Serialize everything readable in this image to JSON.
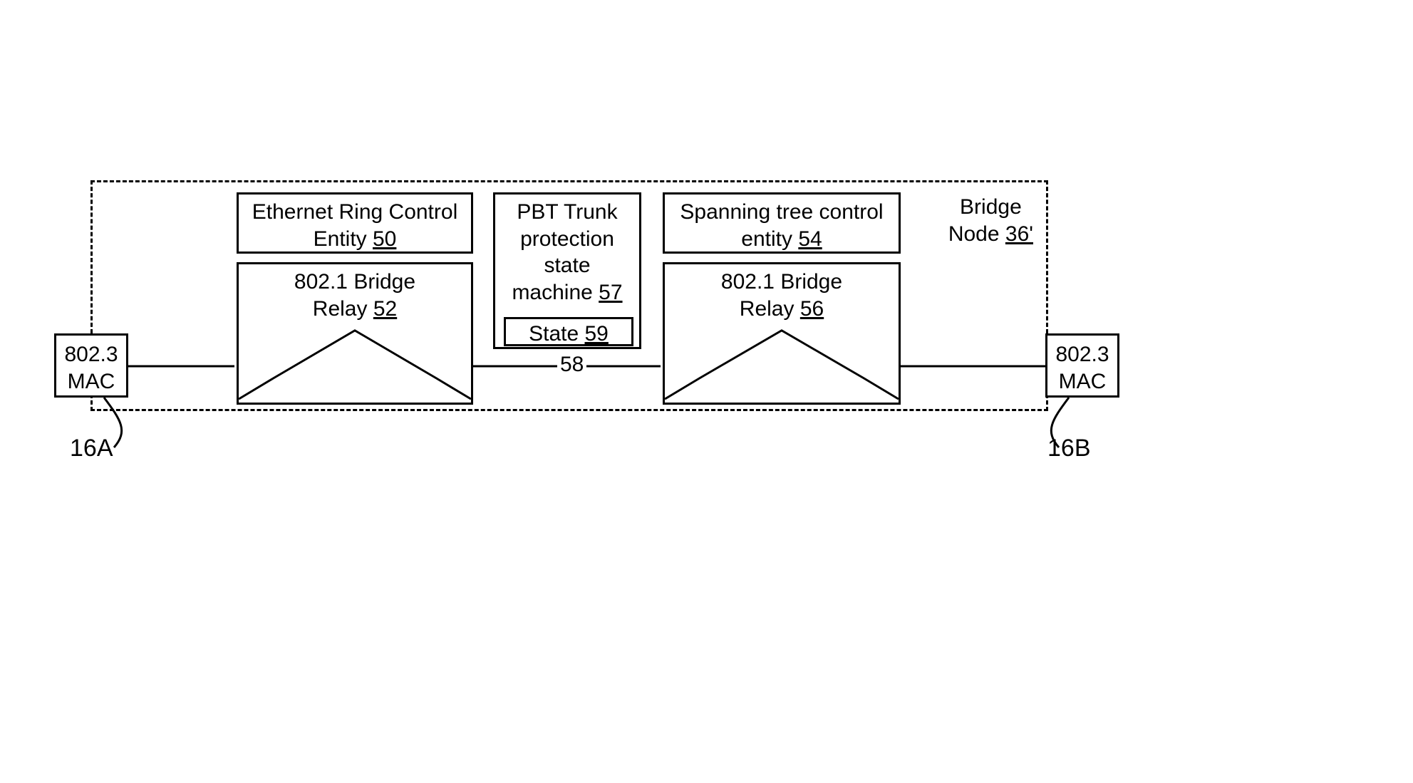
{
  "bridge": {
    "label_line1": "Bridge",
    "label_line2_prefix": "Node ",
    "label_num": "36'"
  },
  "ethernet_ring": {
    "line1": "Ethernet Ring Control",
    "line2_prefix": "Entity ",
    "num": "50"
  },
  "relay_left": {
    "line1": "802.1 Bridge",
    "line2_prefix": "Relay ",
    "num": "52"
  },
  "pbt": {
    "line1": "PBT Trunk",
    "line2": "protection",
    "line3": "state",
    "line4_prefix": "machine ",
    "num": "57",
    "state_prefix": "State ",
    "state_num": "59"
  },
  "spanning": {
    "line1": "Spanning tree control",
    "line2_prefix": "entity ",
    "num": "54"
  },
  "relay_right": {
    "line1": "802.1 Bridge",
    "line2_prefix": "Relay ",
    "num": "56"
  },
  "link_label": "58",
  "mac_left": {
    "line1": "802.3",
    "line2": "MAC"
  },
  "mac_right": {
    "line1": "802.3",
    "line2": "MAC"
  },
  "conn_left_label": "16A",
  "conn_right_label": "16B"
}
